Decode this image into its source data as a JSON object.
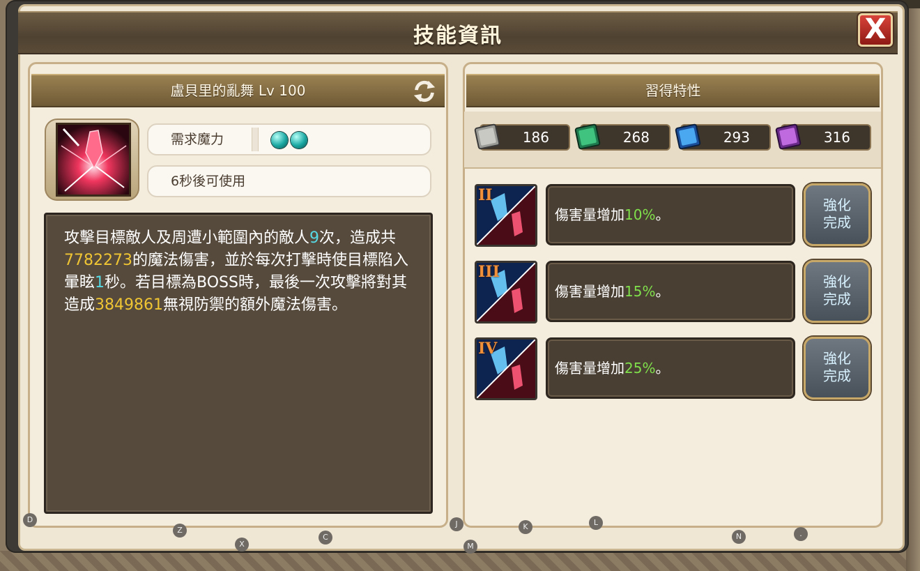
{
  "window": {
    "title": "技能資訊",
    "close_label": "X"
  },
  "skill": {
    "name_header": "盧貝里的亂舞 Lv  100",
    "mana_label": "需求魔力",
    "mana_orbs": 2,
    "cooldown_label": "6秒後可使用",
    "description_parts": [
      {
        "text": "攻擊目標敵人及周遭小範圍內的敵人",
        "color": "white"
      },
      {
        "text": "9",
        "color": "cyan"
      },
      {
        "text": "次，造成共",
        "color": "white"
      },
      {
        "text": "7782273",
        "color": "gold"
      },
      {
        "text": "的魔法傷害，並於每次打擊時使目標陷入暈眩",
        "color": "white"
      },
      {
        "text": "1",
        "color": "cyan"
      },
      {
        "text": "秒。若目標為BOSS時，最後一次攻擊將對其造成",
        "color": "white"
      },
      {
        "text": "3849861",
        "color": "gold"
      },
      {
        "text": "無視防禦的額外魔法傷害。",
        "color": "white"
      }
    ]
  },
  "traits_panel": {
    "header": "習得特性",
    "currencies": [
      {
        "icon": "gray-book-icon",
        "value": "186"
      },
      {
        "icon": "green-book-icon",
        "value": "268"
      },
      {
        "icon": "blue-book-icon",
        "value": "293"
      },
      {
        "icon": "purple-book-icon",
        "value": "316"
      }
    ],
    "traits": [
      {
        "tier": "II",
        "text_prefix": "傷害量增加",
        "value": "10%",
        "text_suffix": "。",
        "button": "強化\n完成"
      },
      {
        "tier": "III",
        "text_prefix": "傷害量增加",
        "value": "15%",
        "text_suffix": "。",
        "button": "強化\n完成"
      },
      {
        "tier": "IV",
        "text_prefix": "傷害量增加",
        "value": "25%",
        "text_suffix": "。",
        "button": "強化\n完成"
      }
    ]
  },
  "hotkeys": [
    "D",
    "Z",
    "X",
    "C",
    "J",
    "M",
    "K",
    "L",
    "N",
    "."
  ],
  "colors": {
    "highlight_gold": "#f0c533",
    "highlight_cyan": "#57d9e4",
    "highlight_green": "#7fe04c",
    "close_red": "#c0302a"
  }
}
